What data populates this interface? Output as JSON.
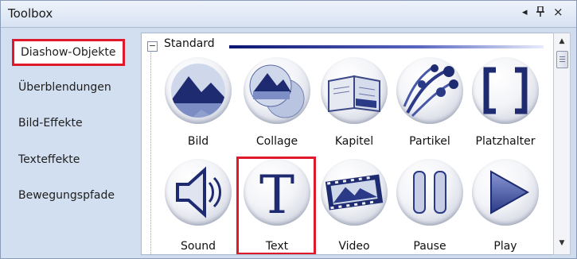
{
  "window": {
    "title": "Toolbox"
  },
  "titlebar_buttons": {
    "dropdown_glyph": "◂",
    "pin_glyph": "ɐ",
    "close_glyph": "×"
  },
  "sidebar": {
    "items": [
      {
        "label": "Diashow-Objekte",
        "selected": true
      },
      {
        "label": "Überblendungen",
        "selected": false
      },
      {
        "label": "Bild-Effekte",
        "selected": false
      },
      {
        "label": "Texteffekte",
        "selected": false
      },
      {
        "label": "Bewegungspfade",
        "selected": false
      }
    ]
  },
  "category": {
    "label": "Standard",
    "toggle_glyph": "−"
  },
  "items": [
    {
      "label": "Bild",
      "icon": "mountain-picture-icon"
    },
    {
      "label": "Collage",
      "icon": "collage-icon"
    },
    {
      "label": "Kapitel",
      "icon": "book-icon"
    },
    {
      "label": "Partikel",
      "icon": "particles-icon"
    },
    {
      "label": "Platzhalter",
      "icon": "brackets-icon"
    },
    {
      "label": "Sound",
      "icon": "speaker-icon"
    },
    {
      "label": "Text",
      "icon": "letter-t-icon",
      "highlighted": true
    },
    {
      "label": "Video",
      "icon": "film-icon"
    },
    {
      "label": "Pause",
      "icon": "pause-icon"
    },
    {
      "label": "Play",
      "icon": "play-icon"
    }
  ],
  "colors": {
    "accent_red": "#e0182b",
    "navy": "#0b1670",
    "sidebar_bg": "#d2dff0"
  }
}
